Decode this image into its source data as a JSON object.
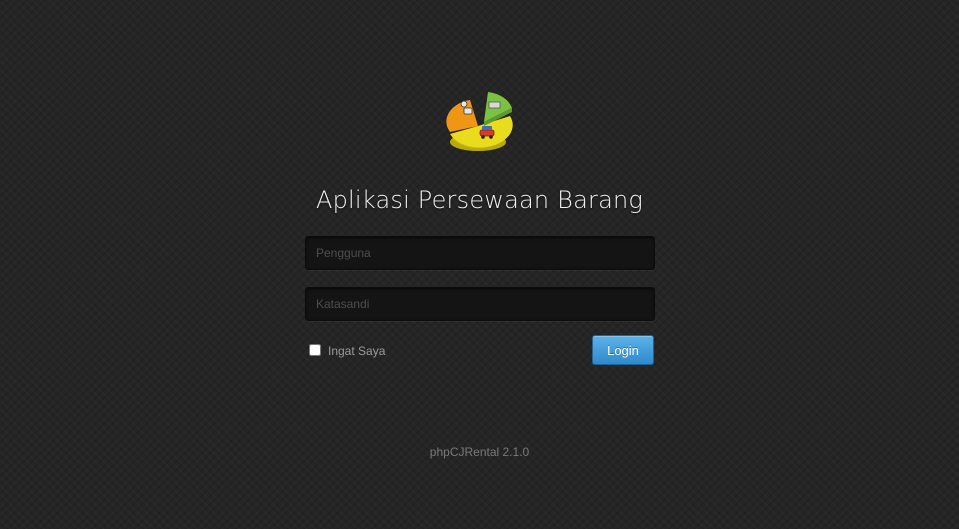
{
  "app": {
    "title": "Aplikasi Persewaan Barang",
    "logo_icon": "pie-chart-rental-logo"
  },
  "login_form": {
    "username_placeholder": "Pengguna",
    "username_value": "",
    "password_placeholder": "Katasandi",
    "password_value": "",
    "remember_label": "Ingat Saya",
    "remember_checked": false,
    "login_label": "Login"
  },
  "footer": {
    "version_text": "phpCJRental 2.1.0"
  },
  "colors": {
    "background": "#252525",
    "button_accent": "#2f8acd",
    "logo_yellow": "#e8dc1c",
    "logo_orange": "#f09616",
    "logo_green": "#7cc242"
  }
}
